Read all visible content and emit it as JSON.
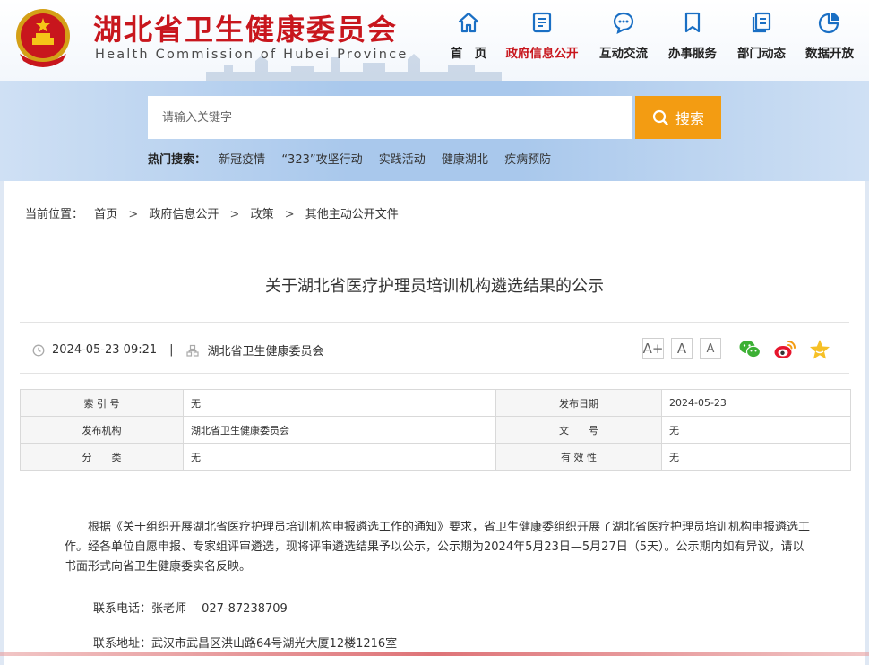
{
  "header": {
    "title_cn": "湖北省卫生健康委员会",
    "title_en": "Health Commission of Hubei Province"
  },
  "nav": [
    {
      "label": "首　页",
      "icon": "home-icon"
    },
    {
      "label": "政府信息公开",
      "icon": "document-list-icon",
      "active": true
    },
    {
      "label": "互动交流",
      "icon": "chat-bubble-icon"
    },
    {
      "label": "办事服务",
      "icon": "bookmark-icon"
    },
    {
      "label": "部门动态",
      "icon": "news-pages-icon"
    },
    {
      "label": "数据开放",
      "icon": "pie-chart-icon"
    }
  ],
  "search": {
    "placeholder": "请输入关键字",
    "button_label": "搜索"
  },
  "hot_search": {
    "label": "热门搜索：",
    "items": [
      "新冠疫情",
      "“323”攻坚行动",
      "实践活动",
      "健康湖北",
      "疾病预防"
    ]
  },
  "breadcrumb": {
    "label": "当前位置：",
    "items": [
      "首页",
      "政府信息公开",
      "政策",
      "其他主动公开文件"
    ],
    "sep": ">"
  },
  "article": {
    "title": "关于湖北省医疗护理员培训机构遴选结果的公示",
    "datetime": "2024-05-23 09:21",
    "pipe": "|",
    "publisher": "湖北省卫生健康委员会",
    "font_controls": [
      "A+",
      "A",
      "A"
    ],
    "info_table": [
      {
        "k1": "索 引 号",
        "v1": "无",
        "k2": "发布日期",
        "v2": "2024-05-23"
      },
      {
        "k1": "发布机构",
        "v1": "湖北省卫生健康委员会",
        "k2": "文　　号",
        "v2": "无"
      },
      {
        "k1": "分　　类",
        "v1": "无",
        "k2": "有 效 性",
        "v2": "无"
      }
    ],
    "body": "根据《关于组织开展湖北省医疗护理员培训机构申报遴选工作的通知》要求，省卫生健康委组织开展了湖北省医疗护理员培训机构申报遴选工作。经各单位自愿申报、专家组评审遴选，现将评审遴选结果予以公示，公示期为2024年5月23日—5月27日（5天）。公示期内如有异议，请以书面形式向省卫生健康委实名反映。",
    "contact_phone": "联系电话：张老师　 027-87238709",
    "contact_address": "联系地址：武汉市武昌区洪山路64号湖光大厦12楼1216室"
  },
  "colors": {
    "brand_red": "#c8161d",
    "search_orange": "#f39c12",
    "icon_blue": "#1a6fc4"
  }
}
